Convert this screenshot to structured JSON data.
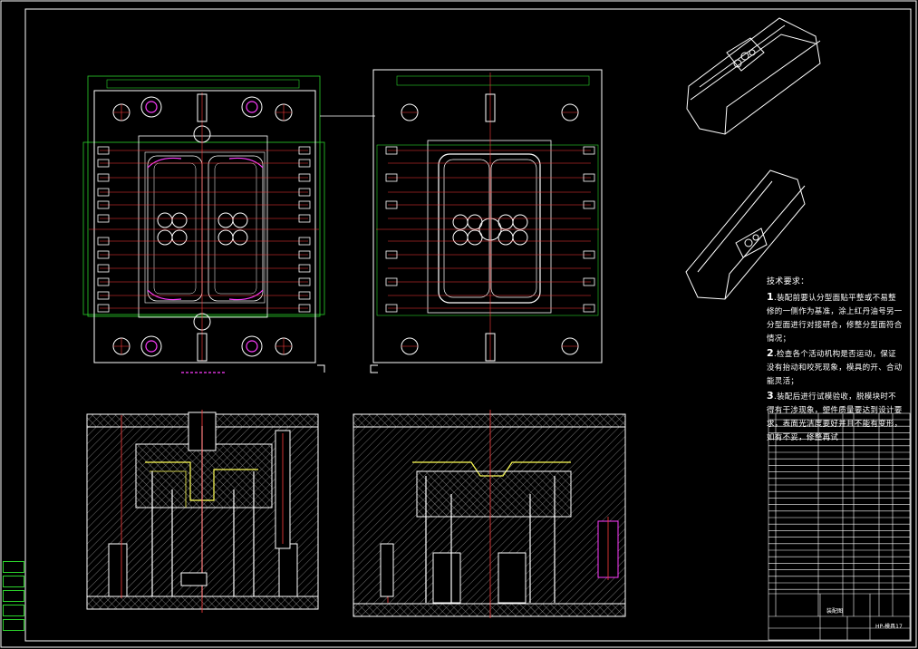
{
  "notes": {
    "title": "技术要求：",
    "items": [
      {
        "num": "1",
        "text": ".装配前要认分型面贴平整或不易整修的一侧作为基准，涂上红丹油号另一分型面进行对接研合，修整分型面符合情况；"
      },
      {
        "num": "2",
        "text": ".检查各个活动机构是否运动，保证没有抬动和咬死现象，模具的开、合动能灵活；"
      },
      {
        "num": "3",
        "text": ".装配后进行试模验收，脱模块时不得有干涉现象，塑件质量要达到设计要求，表面光洁度要好并且不能有变形，如有不妥，修整再试"
      }
    ]
  },
  "title_block": {
    "drawing_title": "装配图",
    "drawing_number": "HP-模具17"
  },
  "colors": {
    "background": "#000000",
    "line": "#ffffff",
    "outline_green": "#2bd32b",
    "magenta": "#ff3dff",
    "red": "#ff3b3b",
    "yellow": "#ffff55",
    "cyan": "#38ffff"
  }
}
